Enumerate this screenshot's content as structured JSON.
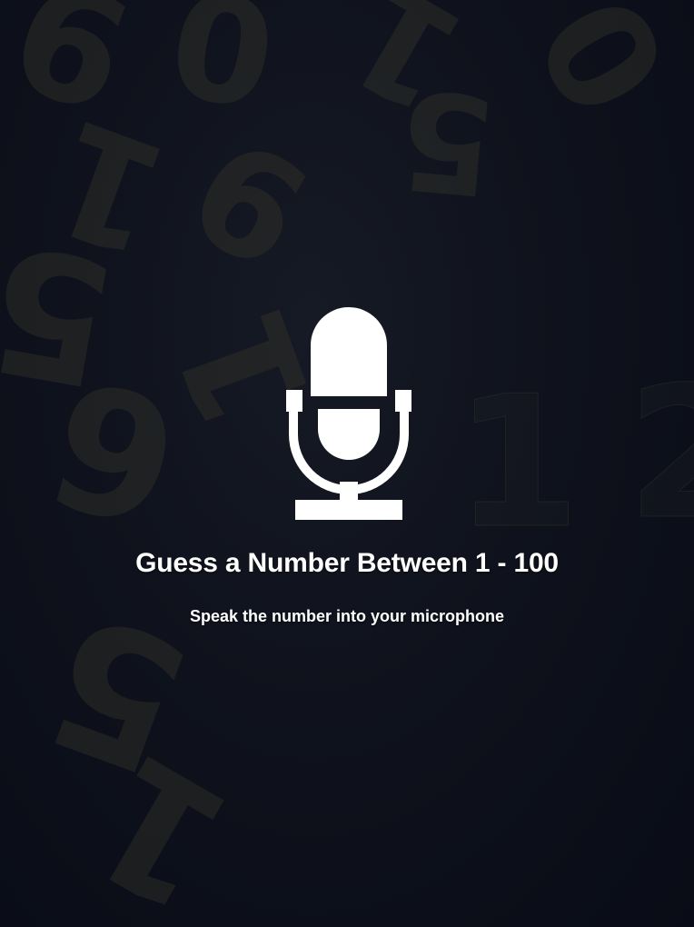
{
  "main": {
    "title": "Guess a Number Between 1 - 100",
    "subtitle": "Speak the number into your microphone",
    "icon": "microphone-icon"
  },
  "background": {
    "digits": [
      "9",
      "0",
      "1",
      "0",
      "5",
      "1",
      "9",
      "5",
      "1",
      "6",
      "1",
      "2",
      "5",
      "1"
    ]
  },
  "colors": {
    "background": "#0d1019",
    "text": "#ffffff",
    "icon": "#ffffff"
  }
}
